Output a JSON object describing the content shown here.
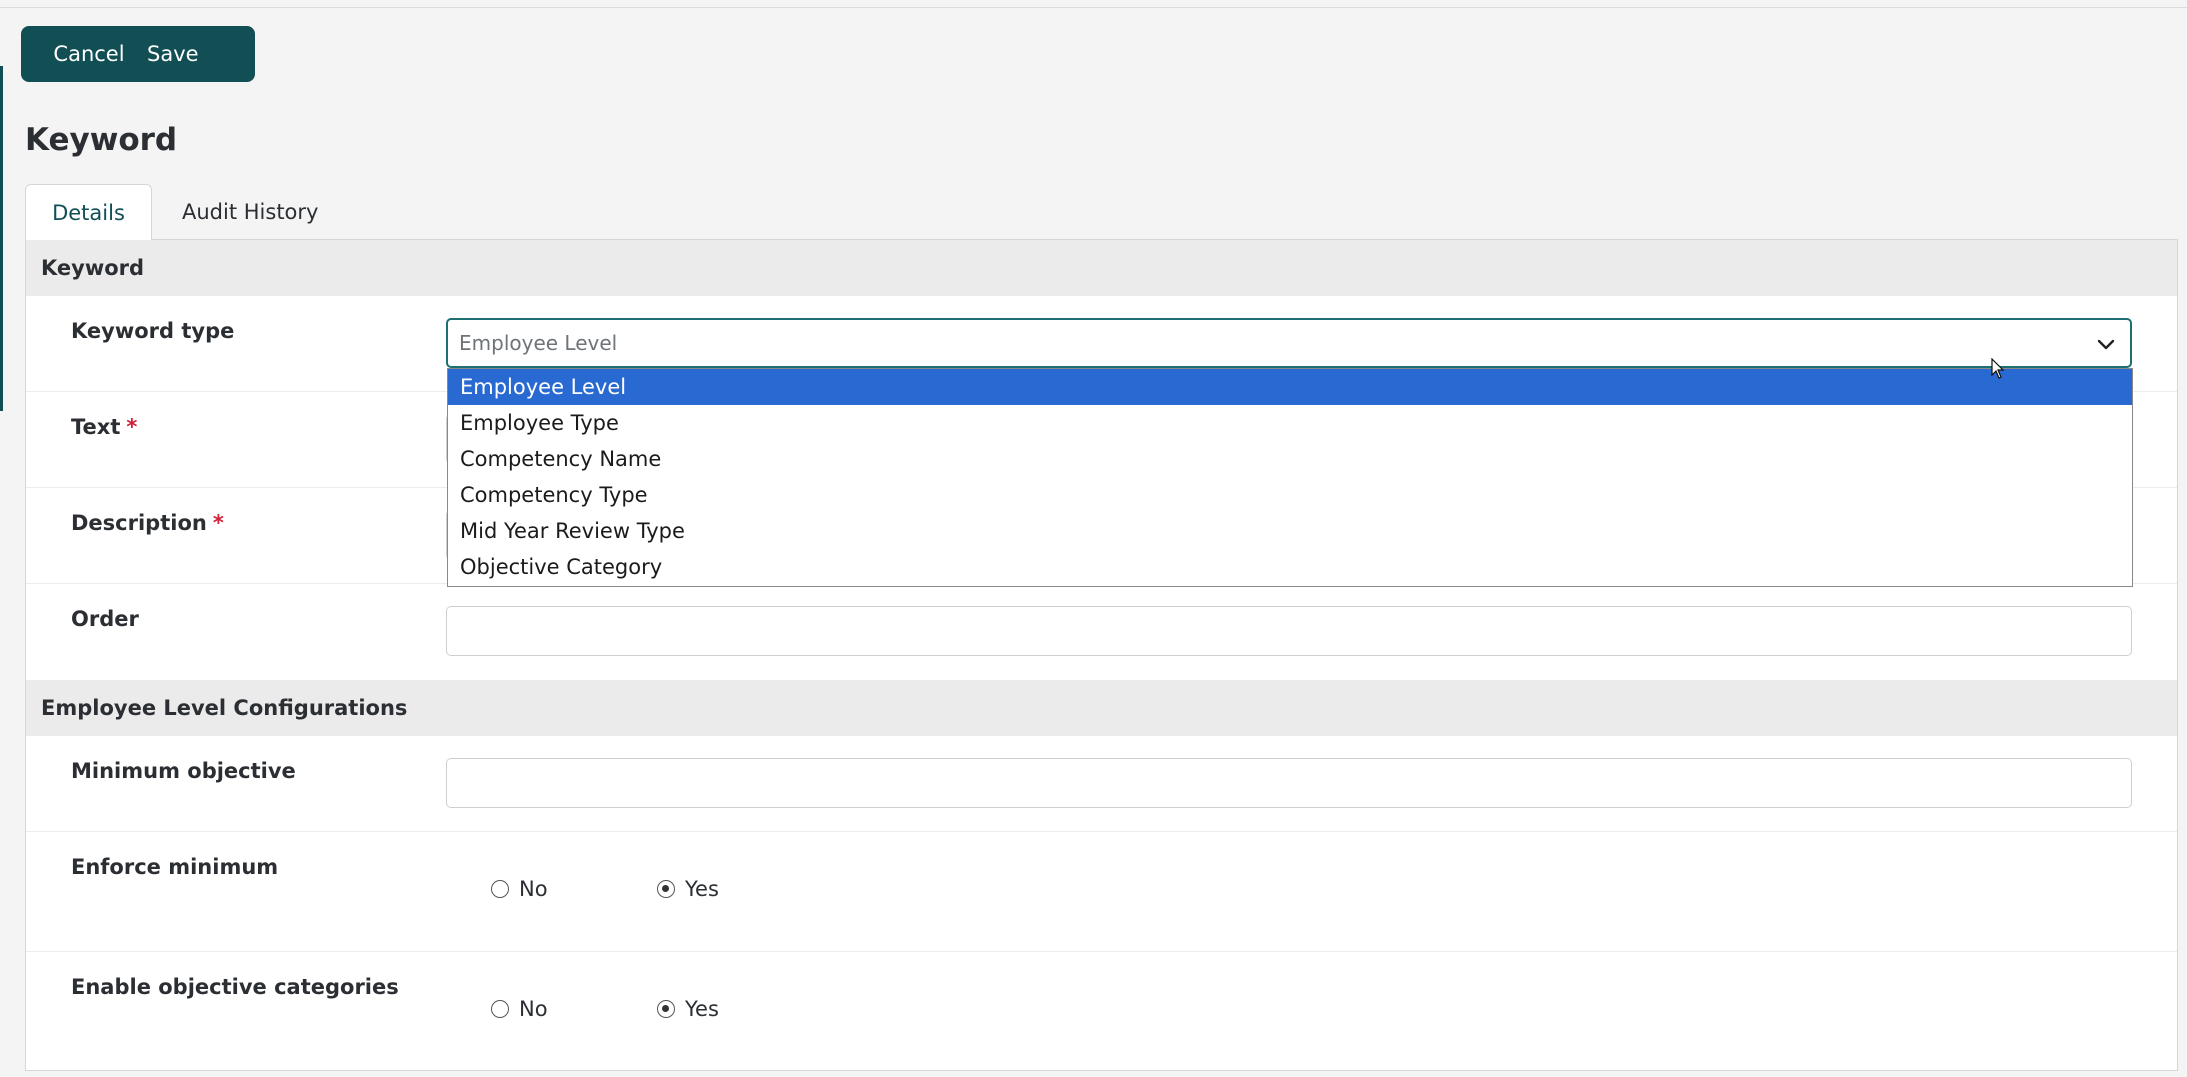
{
  "toolbar": {
    "cancel_label": "Cancel",
    "save_label": "Save"
  },
  "page": {
    "title": "Keyword"
  },
  "tabs": [
    {
      "label": "Details",
      "active": true
    },
    {
      "label": "Audit History",
      "active": false
    }
  ],
  "sections": {
    "keyword": {
      "header": "Keyword",
      "keyword_type": {
        "label": "Keyword type",
        "value": "Employee Level"
      },
      "text": {
        "label": "Text",
        "required_mark": "*",
        "value": ""
      },
      "description": {
        "label": "Description",
        "required_mark": "*",
        "value": ""
      },
      "order": {
        "label": "Order",
        "value": ""
      }
    },
    "config": {
      "header": "Employee Level Configurations",
      "minimum_objective": {
        "label": "Minimum objective",
        "value": ""
      },
      "enforce_minimum": {
        "label": "Enforce minimum",
        "no": "No",
        "yes": "Yes",
        "selected": "Yes"
      },
      "enable_categories": {
        "label": "Enable objective categories",
        "no": "No",
        "yes": "Yes",
        "selected": "Yes"
      }
    }
  },
  "dropdown": {
    "options": [
      "Employee Level",
      "Employee Type",
      "Competency Name",
      "Competency Type",
      "Mid Year Review Type",
      "Objective Category"
    ],
    "selected": "Employee Level"
  },
  "colors": {
    "brand": "#114f55",
    "selected_option": "#2869d2",
    "required": "#d0213a"
  },
  "icons": [
    "chevron-down-icon",
    "mouse-cursor-icon"
  ]
}
